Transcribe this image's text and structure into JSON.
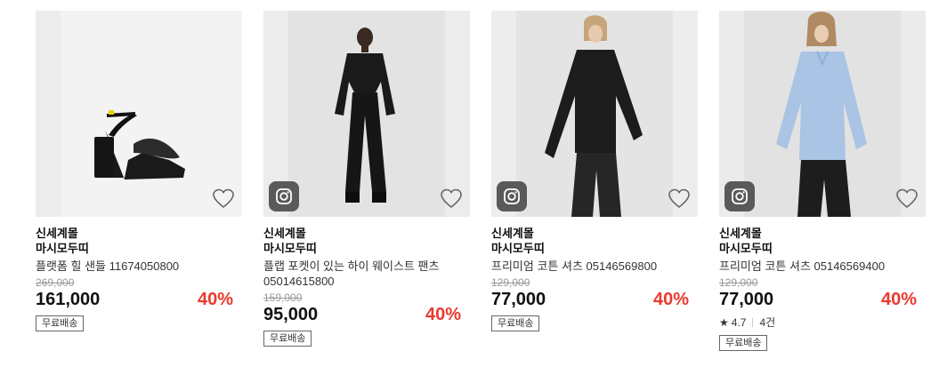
{
  "products": [
    {
      "mall": "신세계몰",
      "brand": "마시모두띠",
      "name": "플랫폼 힐 샌들 11674050800",
      "original_price": "269,000",
      "price": "161,000",
      "discount": "40%",
      "has_instagram": false,
      "shipping": "무료배송",
      "image": "black-platform-sandal"
    },
    {
      "mall": "신세계몰",
      "brand": "마시모두띠",
      "name": "플랩 포켓이 있는 하이 웨이스트 팬츠 05014615800",
      "original_price": "159,000",
      "price": "95,000",
      "discount": "40%",
      "has_instagram": true,
      "shipping": "무료배송",
      "image": "model-black-suit"
    },
    {
      "mall": "신세계몰",
      "brand": "마시모두띠",
      "name": "프리미엄 코튼 셔츠 05146569800",
      "original_price": "129,000",
      "price": "77,000",
      "discount": "40%",
      "has_instagram": true,
      "shipping": "무료배송",
      "image": "model-black-shirt"
    },
    {
      "mall": "신세계몰",
      "brand": "마시모두띠",
      "name": "프리미엄 코튼 셔츠 05146569400",
      "original_price": "129,000",
      "price": "77,000",
      "discount": "40%",
      "has_instagram": true,
      "rating": "4.7",
      "review_count": "4건",
      "shipping": "무료배송",
      "image": "model-blue-shirt"
    }
  ],
  "colors": {
    "discount": "#ea3a2f",
    "insta_badge": "#5a5a5a"
  }
}
